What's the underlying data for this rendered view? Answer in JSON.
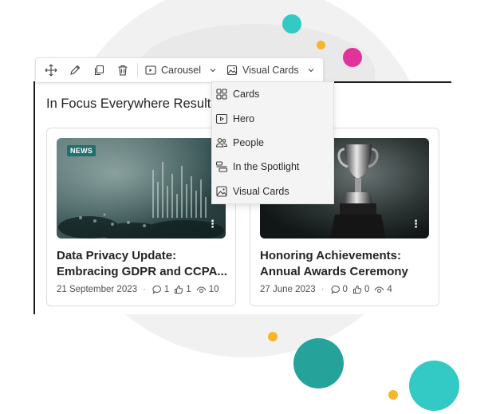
{
  "toolbar": {
    "move_icon": "move-icon",
    "edit_icon": "edit-icon",
    "duplicate_icon": "duplicate-icon",
    "delete_icon": "delete-icon",
    "layout_label": "Carousel",
    "card_style_label": "Visual Cards"
  },
  "section": {
    "title": "In Focus Everywhere Results"
  },
  "menu": {
    "items": [
      {
        "label": "Cards",
        "icon": "cards-icon"
      },
      {
        "label": "Hero",
        "icon": "hero-icon"
      },
      {
        "label": "People",
        "icon": "people-icon"
      },
      {
        "label": "In the Spotlight",
        "icon": "spotlight-icon"
      },
      {
        "label": "Visual Cards",
        "icon": "visual-cards-icon"
      }
    ]
  },
  "cards": [
    {
      "badge": "NEWS",
      "title_line1": "Data Privacy Update:",
      "title_line2": "Embracing GDPR and CCPA...",
      "date": "21 September 2023",
      "comments": "1",
      "likes": "1",
      "views": "10"
    },
    {
      "title_line1": "Honoring Achievements:",
      "title_line2": "Annual Awards Ceremony",
      "date": "27 June 2023",
      "comments": "0",
      "likes": "0",
      "views": "4"
    }
  ],
  "colors": {
    "teal": "#33c9c4",
    "dark_teal": "#25a39a",
    "orange": "#f7b52c",
    "pink": "#e0339c",
    "badge": "#1e6f6e"
  }
}
